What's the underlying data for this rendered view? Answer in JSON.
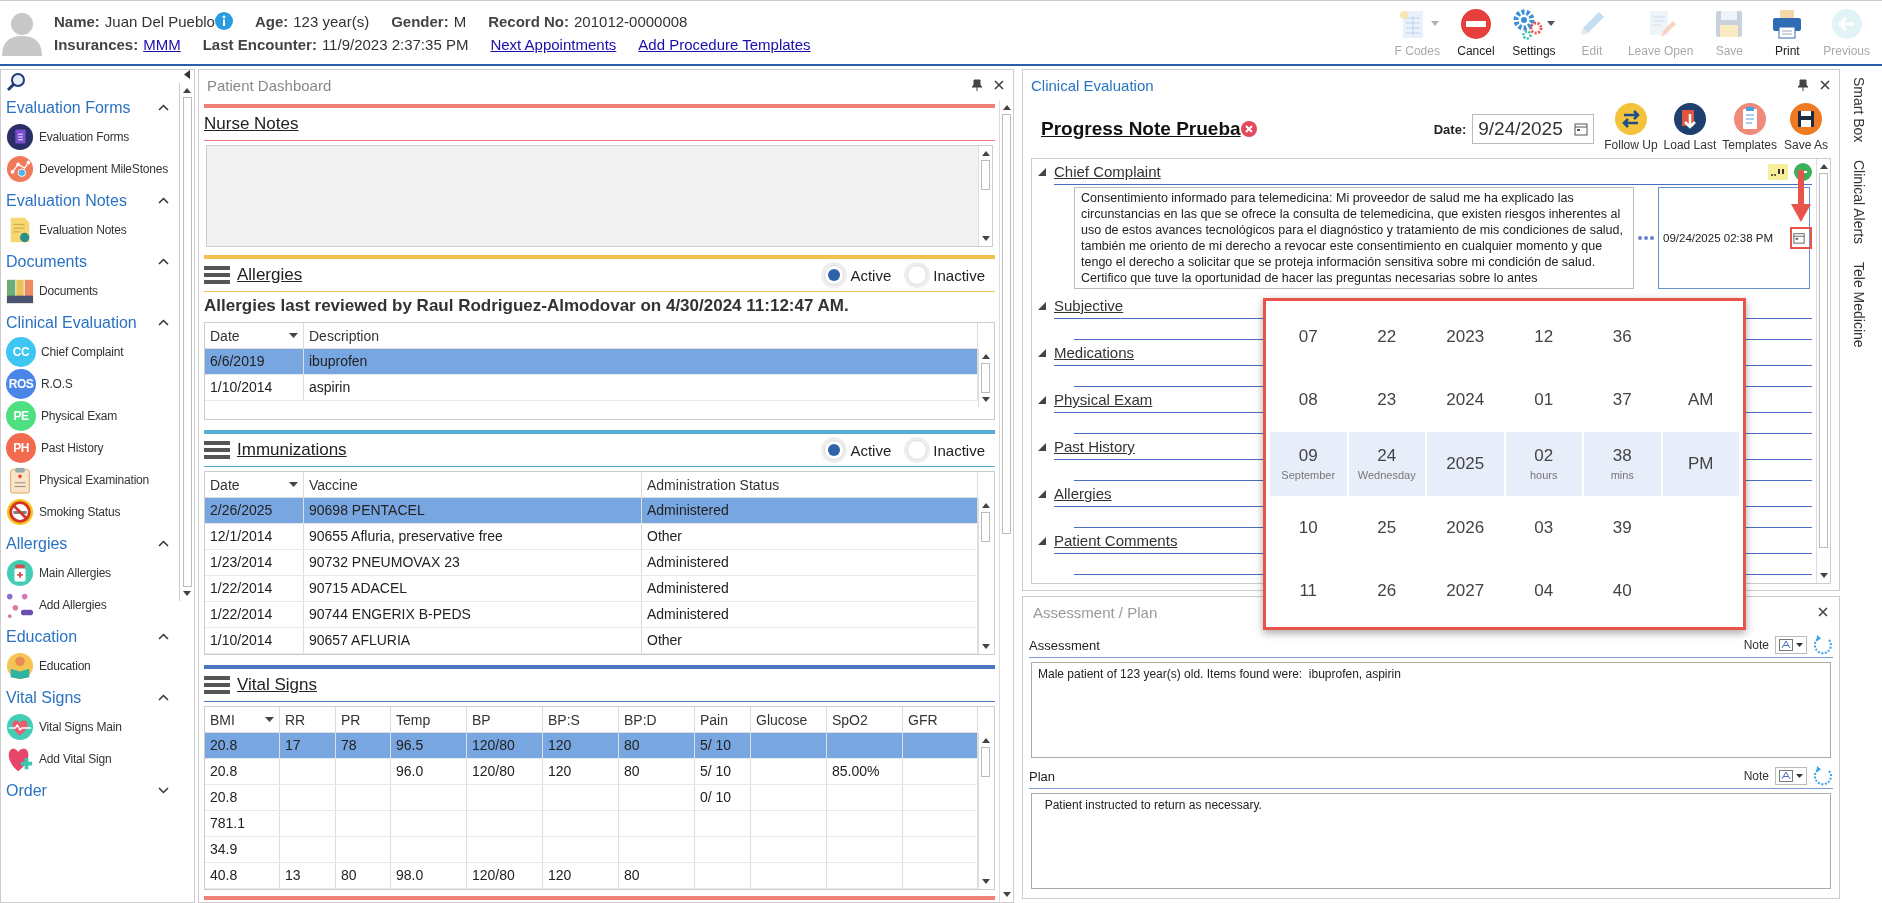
{
  "patient": {
    "row1": [
      {
        "label": "Name:",
        "value": "Juan Del Pueblo",
        "kind": "info"
      },
      {
        "label": "Age:",
        "value": "123 year(s)",
        "kind": "plain"
      },
      {
        "label": "Gender:",
        "value": "M",
        "kind": "plain"
      },
      {
        "label": "Record No:",
        "value": "201012-0000008",
        "kind": "plain"
      }
    ],
    "row2": [
      {
        "label": "Insurances:",
        "value": "MMM",
        "kind": "link"
      },
      {
        "label": "Last Encounter:",
        "value": "11/9/2023 2:37:35 PM",
        "kind": "plain"
      }
    ],
    "links": [
      "Next Appointments",
      "Add Procedure Templates"
    ]
  },
  "toolbar": [
    {
      "label": "F Codes",
      "kind": "fcodes",
      "disabled": true,
      "dropdown": true
    },
    {
      "label": "Cancel",
      "kind": "cancel",
      "disabled": false,
      "dropdown": false
    },
    {
      "label": "Settings",
      "kind": "settings",
      "disabled": false,
      "dropdown": true
    },
    {
      "label": "Edit",
      "kind": "edit",
      "disabled": true,
      "dropdown": false
    },
    {
      "label": "Leave Open",
      "kind": "leave",
      "disabled": true,
      "dropdown": false
    },
    {
      "label": "Save",
      "kind": "save",
      "disabled": true,
      "dropdown": false
    },
    {
      "label": "Print",
      "kind": "print",
      "disabled": false,
      "dropdown": false
    },
    {
      "label": "Previous",
      "kind": "previous",
      "disabled": true,
      "dropdown": false
    }
  ],
  "sidebar": {
    "groups": [
      {
        "title": "Evaluation Forms",
        "expanded": true,
        "items": [
          {
            "label": "Evaluation Forms",
            "kind": "form"
          },
          {
            "label": "Development MileStones",
            "kind": "milestones"
          }
        ]
      },
      {
        "title": "Evaluation Notes",
        "expanded": true,
        "items": [
          {
            "label": "Evaluation Notes",
            "kind": "notes"
          }
        ]
      },
      {
        "title": "Documents",
        "expanded": true,
        "items": [
          {
            "label": "Documents",
            "kind": "documents"
          }
        ]
      },
      {
        "title": "Clinical Evaluation",
        "expanded": true,
        "items": [
          {
            "label": "Chief Complaint",
            "kind": "letters",
            "badge": "CC",
            "color": "#3ec6f2"
          },
          {
            "label": "R.O.S",
            "kind": "letters",
            "badge": "ROS",
            "color": "#4a86e8"
          },
          {
            "label": "Physical Exam",
            "kind": "letters",
            "badge": "PE",
            "color": "#4ddf80"
          },
          {
            "label": "Past History",
            "kind": "letters",
            "badge": "PH",
            "color": "#f26b4f"
          },
          {
            "label": "Physical Examination",
            "kind": "exam"
          },
          {
            "label": "Smoking Status",
            "kind": "smoking"
          }
        ]
      },
      {
        "title": "Allergies",
        "expanded": true,
        "items": [
          {
            "label": "Main Allergies",
            "kind": "bottle"
          },
          {
            "label": "Add Allergies",
            "kind": "pills"
          }
        ]
      },
      {
        "title": "Education",
        "expanded": true,
        "items": [
          {
            "label": "Education",
            "kind": "education"
          }
        ]
      },
      {
        "title": "Vital Signs",
        "expanded": true,
        "items": [
          {
            "label": "Vital Signs Main",
            "kind": "vitals"
          },
          {
            "label": "Add Vital Sign",
            "kind": "addvital"
          }
        ]
      },
      {
        "title": "Order",
        "expanded": false
      }
    ]
  },
  "dashboard": {
    "title": "Patient Dashboard",
    "nurse_notes": {
      "title": "Nurse Notes"
    },
    "allergies": {
      "title": "Allergies",
      "filters": [
        {
          "label": "Active",
          "selected": true
        },
        {
          "label": "Inactive",
          "selected": false
        }
      ],
      "review_note": "Allergies last reviewed by Raul Rodriguez-Almodovar on 4/30/2024 11:12:47 AM.",
      "columns": [
        "Date",
        "Description"
      ],
      "rows": [
        {
          "selected": true,
          "cells": [
            "6/6/2019",
            "ibuprofen"
          ]
        },
        {
          "selected": false,
          "cells": [
            "1/10/2014",
            "aspirin"
          ]
        }
      ]
    },
    "immunizations": {
      "title": "Immunizations",
      "filters": [
        {
          "label": "Active",
          "selected": true
        },
        {
          "label": "Inactive",
          "selected": false
        }
      ],
      "columns": [
        "Date",
        "Vaccine",
        "Administration Status"
      ],
      "rows": [
        {
          "selected": true,
          "cells": [
            "2/26/2025",
            "90698 PENTACEL",
            "Administered"
          ]
        },
        {
          "selected": false,
          "cells": [
            "12/1/2014",
            "90655 Afluria, preservative free",
            "Other"
          ]
        },
        {
          "selected": false,
          "cells": [
            "1/23/2014",
            "90732 PNEUMOVAX 23",
            "Administered"
          ]
        },
        {
          "selected": false,
          "cells": [
            "1/22/2014",
            "90715 ADACEL",
            "Administered"
          ]
        },
        {
          "selected": false,
          "cells": [
            "1/22/2014",
            "90744 ENGERIX B-PEDS",
            "Administered"
          ]
        },
        {
          "selected": false,
          "cells": [
            "1/10/2014",
            "90657 AFLURIA",
            "Other"
          ]
        }
      ]
    },
    "vital_signs": {
      "title": "Vital Signs",
      "columns": [
        "BMI",
        "RR",
        "PR",
        "Temp",
        "BP",
        "BP:S",
        "BP:D",
        "Pain",
        "Glucose",
        "SpO2",
        "GFR"
      ],
      "rows": [
        {
          "selected": true,
          "cells": [
            "20.8",
            "17",
            "78",
            "96.5",
            "120/80",
            "120",
            "80",
            "5/ 10",
            "",
            "",
            ""
          ]
        },
        {
          "selected": false,
          "cells": [
            "20.8",
            "",
            "",
            "96.0",
            "120/80",
            "120",
            "80",
            "5/ 10",
            "",
            "85.00%",
            ""
          ]
        },
        {
          "selected": false,
          "cells": [
            "20.8",
            "",
            "",
            "",
            "",
            "",
            "",
            "0/ 10",
            "",
            "",
            ""
          ]
        },
        {
          "selected": false,
          "cells": [
            "781.1",
            "",
            "",
            "",
            "",
            "",
            "",
            "",
            "",
            "",
            ""
          ]
        },
        {
          "selected": false,
          "cells": [
            "34.9",
            "",
            "",
            "",
            "",
            "",
            "",
            "",
            "",
            "",
            ""
          ]
        },
        {
          "selected": false,
          "cells": [
            "40.8",
            "13",
            "80",
            "98.0",
            "120/80",
            "120",
            "80",
            "",
            "",
            "",
            ""
          ]
        }
      ]
    }
  },
  "clinical_evaluation": {
    "title": "Clinical Evaluation",
    "note_title": "Progress Note Prueba",
    "date_label": "Date:",
    "date": "9/24/2025",
    "actions": [
      {
        "label": "Follow Up",
        "kind": "followup"
      },
      {
        "label": "Load Last",
        "kind": "loadlast"
      },
      {
        "label": "Templates",
        "kind": "templates"
      },
      {
        "label": "Save As",
        "kind": "saveas"
      }
    ],
    "sections": [
      {
        "title": "Chief Complaint",
        "expanded": true,
        "text": "Consentimiento informado para telemedicina:  Mi proveedor de salud me ha explicado las circunstancias en las que se ofrece la consulta de telemedicina, que existen riesgos inherentes al uso de estos avances tecnológicos para el diagnóstico y tratamiento de mis condiciones de salud, también me oriento de mi derecho a revocar este consentimiento en cualquier momento y que tengo el derecho a solicitar que se proteja información sensitiva sobre mi condición de salud.  Certifico que tuve la oportunidad de hacer las preguntas necesarias sobre lo antes",
        "datetime": "09/24/2025 02:38 PM"
      },
      {
        "title": "Subjective",
        "expanded": true
      },
      {
        "title": "Medications",
        "expanded": true
      },
      {
        "title": "Physical Exam",
        "expanded": true
      },
      {
        "title": "Past History",
        "expanded": true
      },
      {
        "title": "Allergies",
        "expanded": true
      },
      {
        "title": "Patient Comments",
        "expanded": true
      }
    ]
  },
  "date_picker": {
    "rows": [
      {
        "selected": false,
        "cells": [
          {
            "value": "07"
          },
          {
            "value": "22"
          },
          {
            "value": "2023"
          },
          {
            "value": "12"
          },
          {
            "value": "36"
          }
        ]
      },
      {
        "selected": false,
        "cells": [
          {
            "value": "08"
          },
          {
            "value": "23"
          },
          {
            "value": "2024"
          },
          {
            "value": "01"
          },
          {
            "value": "37"
          },
          {
            "value": "AM"
          }
        ]
      },
      {
        "selected": true,
        "cells": [
          {
            "value": "09",
            "caption": "September"
          },
          {
            "value": "24",
            "caption": "Wednesday"
          },
          {
            "value": "2025"
          },
          {
            "value": "02",
            "caption": "hours"
          },
          {
            "value": "38",
            "caption": "mins"
          },
          {
            "value": "PM"
          }
        ]
      },
      {
        "selected": false,
        "cells": [
          {
            "value": "10"
          },
          {
            "value": "25"
          },
          {
            "value": "2026"
          },
          {
            "value": "03"
          },
          {
            "value": "39"
          }
        ]
      },
      {
        "selected": false,
        "cells": [
          {
            "value": "11"
          },
          {
            "value": "26"
          },
          {
            "value": "2027"
          },
          {
            "value": "04"
          },
          {
            "value": "40"
          }
        ]
      }
    ]
  },
  "assessment_plan": {
    "title": "Assessment / Plan",
    "sections": [
      {
        "label": "Assessment",
        "note_label": "Note",
        "text": "Male patient of 123 year(s) old. Items found were:  ibuprofen, aspirin"
      },
      {
        "label": "Plan",
        "note_label": "Note",
        "text": "  Patient instructed to return as necessary."
      }
    ]
  },
  "side_tabs": [
    "Smart Box",
    "Clinical Alerts",
    "Tele Medicine"
  ]
}
